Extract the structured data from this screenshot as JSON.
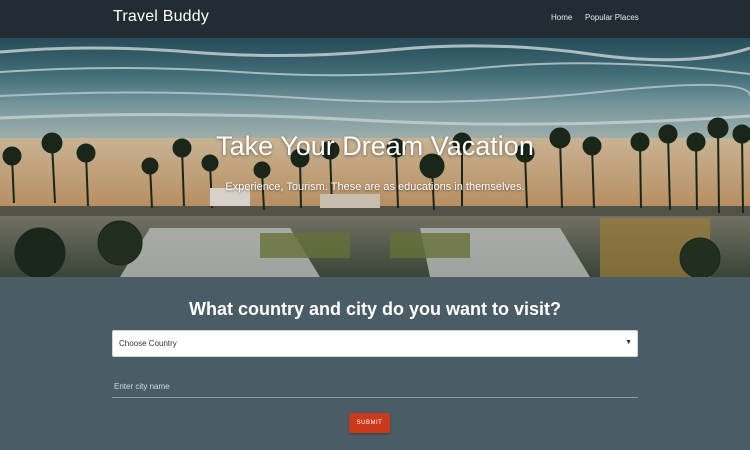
{
  "nav": {
    "brand": "Travel Buddy",
    "links": [
      "Home",
      "Popular Places"
    ]
  },
  "hero": {
    "title": "Take Your Dream Vacation",
    "subtitle": "Experience, Tourism. These are as educations in themselves."
  },
  "form": {
    "question": "What country and city do you want to visit?",
    "country_select": "Choose Country",
    "city_placeholder": "Enter city name",
    "submit_label": "SUBMIT"
  },
  "colors": {
    "navbar": "#242c33",
    "background": "#4a5d66",
    "submit": "#c9391a"
  }
}
